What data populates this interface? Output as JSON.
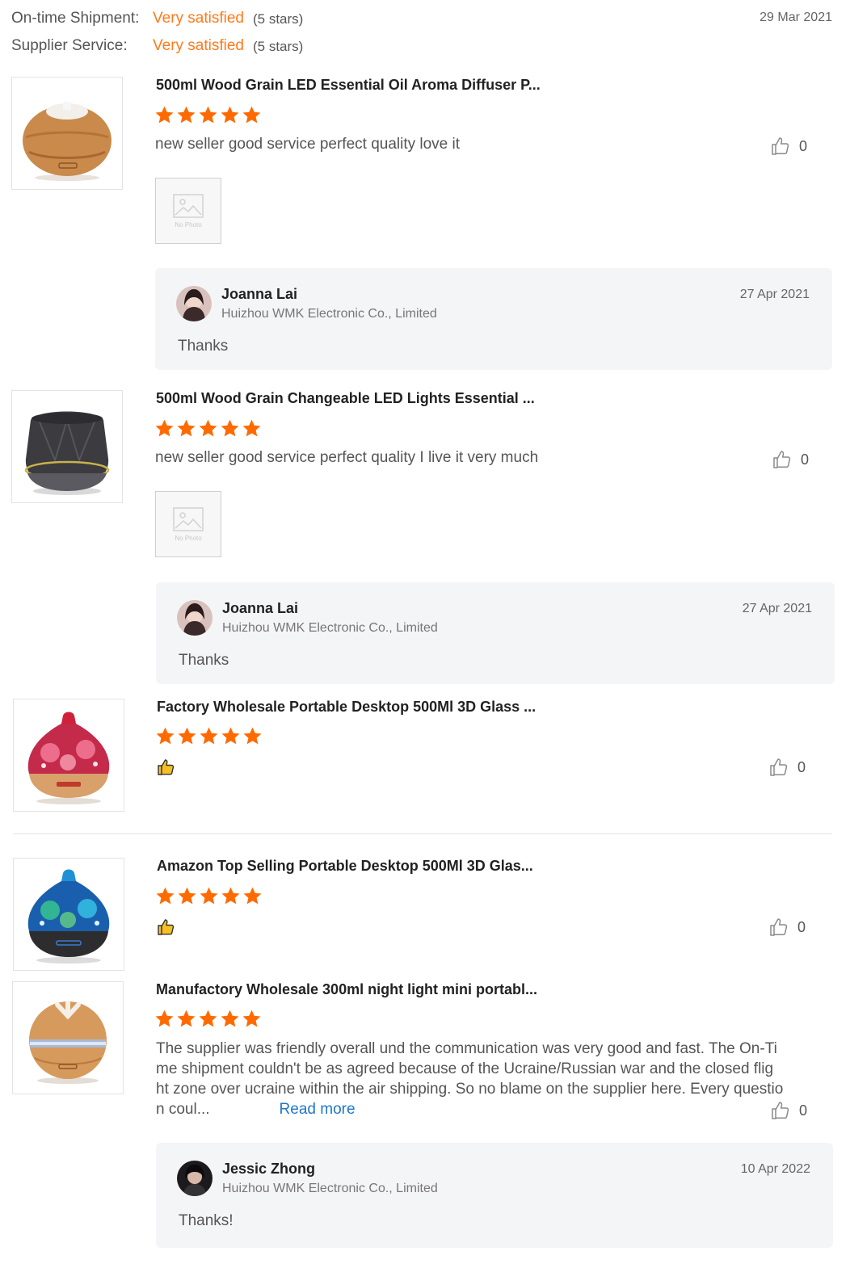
{
  "summary": {
    "shipment_label": "On-time Shipment:",
    "shipment_value": "Very satisfied",
    "shipment_stars": "(5 stars)",
    "service_label": "Supplier Service:",
    "service_value": "Very satisfied",
    "service_stars": "(5 stars)",
    "date": "29 Mar 2021"
  },
  "colors": {
    "accent": "#ff7a1a",
    "star": "#ff6a00",
    "link": "#1f77c9",
    "reply_bg": "#f4f5f7"
  },
  "reviews": [
    {
      "title": "500ml Wood Grain LED Essential Oil Aroma Diffuser P...",
      "rating": 5,
      "text": "new seller good service perfect quality love it",
      "likes": "0",
      "no_photo": "No Photo",
      "reply": {
        "name": "Joanna Lai",
        "company": "Huizhou WMK Electronic Co., Limited",
        "date": "27 Apr 2021",
        "text": "Thanks"
      }
    },
    {
      "title": "500ml Wood Grain Changeable LED Lights Essential ...",
      "rating": 5,
      "text": "new seller good service perfect quality I live it very much",
      "likes": "0",
      "no_photo": "No Photo",
      "reply": {
        "name": "Joanna Lai",
        "company": "Huizhou WMK Electronic Co., Limited",
        "date": "27 Apr 2021",
        "text": "Thanks"
      }
    },
    {
      "title": "Factory Wholesale Portable Desktop 500Ml 3D Glass ...",
      "rating": 5,
      "text_icon": "thumbs-up-emoji",
      "likes": "0"
    },
    {
      "title": "Amazon Top Selling Portable Desktop 500Ml 3D Glas...",
      "rating": 5,
      "text_icon": "thumbs-up-emoji",
      "likes": "0"
    },
    {
      "title": "Manufactory Wholesale 300ml night light mini portabl...",
      "rating": 5,
      "text_lines": [
        "The supplier was friendly overall und the communication was very good and fast. The On-Ti",
        "me shipment couldn't be as agreed because of the Ucraine/Russian war and the closed flig",
        "ht zone over ucraine within the air shipping. So no blame on the supplier here. Every questio",
        "n coul..."
      ],
      "read_more": "Read more",
      "likes": "0",
      "reply": {
        "name": "Jessic Zhong",
        "company": "Huizhou WMK Electronic Co., Limited",
        "date": "10 Apr 2022",
        "text": "Thanks!"
      }
    }
  ]
}
